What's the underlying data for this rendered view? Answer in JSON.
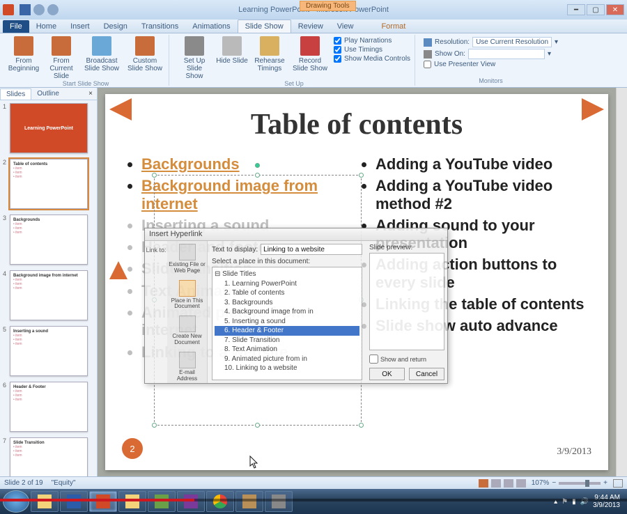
{
  "window": {
    "doc_title": "Learning PowerPoint",
    "app_name": "Microsoft PowerPoint",
    "context_tab": "Drawing Tools"
  },
  "tabs": {
    "file": "File",
    "home": "Home",
    "insert": "Insert",
    "design": "Design",
    "transitions": "Transitions",
    "animations": "Animations",
    "slideshow": "Slide Show",
    "review": "Review",
    "view": "View",
    "format": "Format"
  },
  "ribbon": {
    "from_beginning": "From Beginning",
    "from_current": "From Current Slide",
    "broadcast": "Broadcast Slide Show",
    "custom": "Custom Slide Show",
    "start_group": "Start Slide Show",
    "setup": "Set Up Slide Show",
    "hide": "Hide Slide",
    "rehearse": "Rehearse Timings",
    "record": "Record Slide Show",
    "play_narr": "Play Narrations",
    "use_timings": "Use Timings",
    "media_ctrl": "Show Media Controls",
    "setup_group": "Set Up",
    "resolution_label": "Resolution:",
    "resolution_value": "Use Current Resolution",
    "show_on_label": "Show On:",
    "presenter_view": "Use Presenter View",
    "monitors_group": "Monitors"
  },
  "pane": {
    "slides": "Slides",
    "outline": "Outline"
  },
  "thumbs": [
    {
      "n": "1",
      "title": "Learning PowerPoint",
      "kind": "title"
    },
    {
      "n": "2",
      "title": "Table of contents",
      "kind": "toc",
      "sel": true
    },
    {
      "n": "3",
      "title": "Backgrounds",
      "kind": "body"
    },
    {
      "n": "4",
      "title": "Background image from internet",
      "kind": "body"
    },
    {
      "n": "5",
      "title": "Inserting a sound",
      "kind": "body"
    },
    {
      "n": "6",
      "title": "Header & Footer",
      "kind": "body"
    },
    {
      "n": "7",
      "title": "Slide Transition",
      "kind": "body"
    }
  ],
  "slide": {
    "title": "Table of contents",
    "left": {
      "linked": [
        "Backgrounds",
        "Background image from internet"
      ],
      "gray": [
        "Inserting a sound",
        "Header and footer",
        "Slide transition",
        "Text Animation",
        "Animated picture from internet",
        "Linking to a website"
      ]
    },
    "right": [
      "Adding a YouTube video",
      "Adding a YouTube video method #2",
      "Adding sound to your presentation",
      "Adding action buttons to every slide",
      "Linking the table of contents",
      "Slide show auto advance"
    ],
    "page_number": "2",
    "date": "3/9/2013"
  },
  "dialog": {
    "title": "Insert Hyperlink",
    "linkto_label": "Link to:",
    "text_label": "Text to display:",
    "text_value": "Linking to a website",
    "select_label": "Select a place in this document:",
    "preview_label": "Slide preview:",
    "show_return": "Show and return",
    "ok": "OK",
    "cancel": "Cancel",
    "side": {
      "existing": "Existing File or Web Page",
      "place": "Place in This Document",
      "newdoc": "Create New Document",
      "email": "E-mail Address"
    },
    "tree_root": "Slide Titles",
    "tree": [
      "1. Learning PowerPoint",
      "2. Table of contents",
      "3. Backgrounds",
      "4. Background image from in",
      "5. Inserting a sound",
      "6. Header & Footer",
      "7. Slide Transition",
      "8. Text Animation",
      "9. Animated picture from in",
      "10. Linking to a website"
    ]
  },
  "status": {
    "slide_info": "Slide 2 of 19",
    "theme": "\"Equity\"",
    "zoom": "107%"
  },
  "taskbar": {
    "time": "9:44 AM",
    "date": "3/9/2013"
  },
  "colors": {
    "accent": "#da6a34",
    "link": "#d48c3d"
  }
}
